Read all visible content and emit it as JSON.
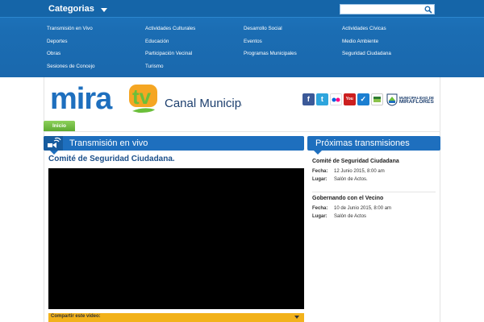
{
  "topbar": {
    "categories_label": "Categorias",
    "search_placeholder": "",
    "categories": [
      "Transmisión en Vivo",
      "Actividades Culturales",
      "Desarrollo Social",
      "Actividades Cívicas",
      "Deportes",
      "Educación",
      "Eventos",
      "Medio Ambiente",
      "Obras",
      "Participación Vecinal",
      "Programas Municipales",
      "Seguridad Ciudadana",
      "Sesiones de Concejo",
      "Turismo"
    ]
  },
  "header": {
    "logo_main": "mira",
    "logo_tv": "tv",
    "logo_subtitle": "Canal Municipal",
    "social": [
      {
        "icon": "facebook-icon",
        "glyph": "f",
        "color": "#3b5998"
      },
      {
        "icon": "twitter-icon",
        "glyph": "t",
        "color": "#2ea5dd"
      },
      {
        "icon": "flickr-icon",
        "glyph": "●●",
        "color": "#ffffff"
      },
      {
        "icon": "youtube-icon",
        "glyph": "You",
        "color": "#cc1f1f"
      },
      {
        "icon": "check-icon",
        "glyph": "✓",
        "color": "#1b7fd1"
      },
      {
        "icon": "rss-icon",
        "glyph": "rss",
        "color": "#ffffff"
      }
    ],
    "municipality_small": "MUNICIPALIDAD DE",
    "municipality_name": "MIRAFLORES"
  },
  "nav": {
    "home_label": "Inicio"
  },
  "live": {
    "header": "Transmisión en vivo",
    "title": "Comité de Seguridad Ciudadana.",
    "share_label": "Compartir este video:"
  },
  "upcoming": {
    "header": "Próximas transmisiones",
    "date_label": "Fecha:",
    "place_label": "Lugar:",
    "events": [
      {
        "title": "Comité de Seguridad Ciudadana",
        "date": "12 Junio 2015, 8:00 am",
        "place": "Salón de Actos."
      },
      {
        "title": "Gobernando con el Vecino",
        "date": "10 de Junio 2015, 8:00 am",
        "place": "Salón de Actos"
      }
    ]
  },
  "colors": {
    "brand_blue": "#1e6fbe",
    "brand_green": "#6bbf3a",
    "brand_orange": "#f5a623",
    "share_bar": "#f2b21b"
  }
}
